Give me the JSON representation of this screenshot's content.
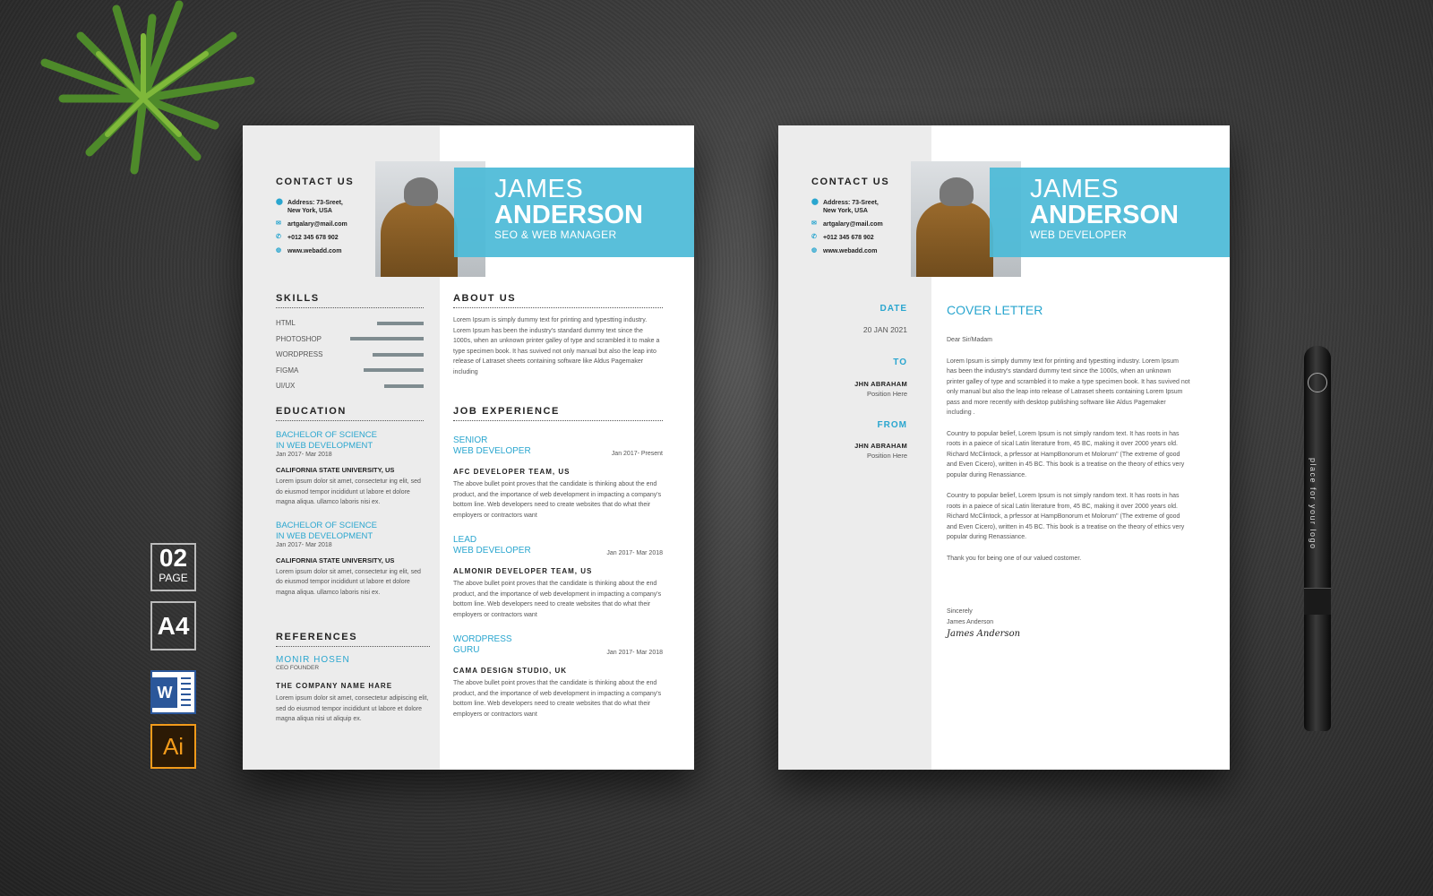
{
  "side_badges": {
    "pages_number": "02",
    "pages_label": "PAGE",
    "paper_size": "A4",
    "word_label": "W",
    "ai_label": "Ai"
  },
  "pen": {
    "logo_text": "place for your logo"
  },
  "resume": {
    "first_name": "JAMES",
    "last_name": "ANDERSON",
    "role": "SEO & WEB MANAGER",
    "contact_title": "CONTACT US",
    "contact": [
      {
        "icon": "location-icon",
        "text": "Address: 73-Sreet,\nNew York, USA"
      },
      {
        "icon": "mail-icon",
        "text": "artgalary@mail.com"
      },
      {
        "icon": "phone-icon",
        "text": "+012 345 678 902"
      },
      {
        "icon": "globe-icon",
        "text": "www.webadd.com"
      }
    ],
    "skills_title": "SKILLS",
    "skills": [
      {
        "name": "HTML",
        "level": 56
      },
      {
        "name": "PHOTOSHOP",
        "level": 89
      },
      {
        "name": "WORDPRESS",
        "level": 62
      },
      {
        "name": "FIGMA",
        "level": 73
      },
      {
        "name": "UI/UX",
        "level": 48
      }
    ],
    "education_title": "EDUCATION",
    "education": [
      {
        "degree1": "BACHELOR OF SCIENCE",
        "degree2": "IN WEB DEVELOPMENT",
        "dates": "Jan 2017- Mar 2018",
        "school": "CALIFORNIA STATE UNIVERSITY, US",
        "desc": "Lorem ipsum dolor sit amet, consectetur ing elit, sed do eiusmod tempor incididunt ut labore et dolore magna aliqua. ullamco laboris nisi ex."
      },
      {
        "degree1": "BACHELOR OF SCIENCE",
        "degree2": "IN WEB DEVELOPMENT",
        "dates": "Jan 2017- Mar 2018",
        "school": "CALIFORNIA STATE UNIVERSITY, US",
        "desc": "Lorem ipsum dolor sit amet, consectetur ing elit, sed do eiusmod tempor incididunt ut labore et dolore magna aliqua. ullamco laboris nisi ex."
      }
    ],
    "references_title": "REFERENCES",
    "reference": {
      "name": "MONIR HOSEN",
      "role": "CEO FOUNDER",
      "company": "THE COMPANY NAME HARE",
      "desc": "Lorem ipsum dolor sit amet, consectetur adipiscing elit, sed do eiusmod tempor incididunt ut labore et dolore magna aliqua nisi ut aliquip ex."
    },
    "about_title": "ABOUT US",
    "about": "Lorem Ipsum is simply dummy text for printing and typestting industry. Lorem Ipsum has been the industry's standard dummy text since the 1000s, when an unknown printer galley of type and scrambled it to make a type specimen book. It has suvived not only manual but also the leap into release of Latraset sheets containing software like Aldus Pagemaker including",
    "jobs_title": "JOB EXPERIENCE",
    "jobs": [
      {
        "title1": "SENIOR",
        "title2": "WEB DEVELOPER",
        "dates": "Jan 2017- Present",
        "company": "AFC DEVELOPER TEAM, US",
        "desc": "The above bullet point proves that the candidate is thinking about the end product, and the importance of web development in impacting a company's bottom line. Web developers need to create websites that do what their employers or contractors want"
      },
      {
        "title1": "LEAD",
        "title2": "WEB DEVELOPER",
        "dates": "Jan 2017- Mar 2018",
        "company": "ALMONIR DEVELOPER TEAM, US",
        "desc": "The above bullet point proves that the candidate is thinking about the end product, and the importance of web development in impacting a company's bottom line. Web developers need to create websites that do what their employers or contractors want"
      },
      {
        "title1": "WORDPRESS",
        "title2": "GURU",
        "dates": "Jan 2017- Mar 2018",
        "company": "CAMA DESIGN STUDIO, UK",
        "desc": "The above bullet point proves that the candidate is thinking about the end product, and the importance of web development in impacting a company's bottom line. Web developers need to create websites that do what their employers or contractors want"
      }
    ]
  },
  "cover": {
    "first_name": "JAMES",
    "last_name": "ANDERSON",
    "role": "WEB DEVELOPER",
    "contact_title": "CONTACT US",
    "contact": [
      {
        "icon": "location-icon",
        "text": "Address: 73-Sreet,\nNew York, USA"
      },
      {
        "icon": "mail-icon",
        "text": "artgalary@mail.com"
      },
      {
        "icon": "phone-icon",
        "text": "+012 345 678 902"
      },
      {
        "icon": "globe-icon",
        "text": "www.webadd.com"
      }
    ],
    "date_label": "DATE",
    "date": "20 JAN 2021",
    "to_label": "TO",
    "to_name": "JHN ABRAHAM",
    "to_position": "Position Here",
    "from_label": "FROM",
    "from_name": "JHN ABRAHAM",
    "from_position": "Position Here",
    "title": "COVER LETTER",
    "greeting": "Dear Sir/Madam",
    "paragraphs": [
      "Lorem Ipsum is simply dummy text for printing and typestting industry. Lorem Ipsum has been the industry's standard dummy text since the 1000s, when an unknown printer galley of type and scrambled it to make a type specimen book. It has suvived not only manual but also the leap into release of Latraset sheets containing Lorem Ipsum pass and more recently with desktop publishing software like Aldus Pagemaker including .",
      "Country to popular belief, Lorem Ipsum is not simply random text. It has roots in has roots in a paiece of sical  Latin literature from, 45 BC, making it over 2000 years old. Richard McClintock, a prfessor at HampBonorum et Molorum\" (The extreme of good and Even Cicero), written in 45 BC. This book is a treatise on the theory of ethics very popular during  Renassiance.",
      "Country to popular belief, Lorem Ipsum is not simply random text. It has roots in  has roots in a paiece of sical  Latin literature from, 45 BC, making it over 2000 years old. Richard McClintock, a prfessor at HampBonorum et Molorum\" (The extreme of good and Even Cicero), written in 45 BC. This book is a treatise on the theory of ethics very popular during  Renassiance.",
      "Thank you for being one of our valued costomer."
    ],
    "closing": "Sincerely",
    "sender": "James Anderson",
    "signature": "James Anderson"
  },
  "colors": {
    "accent": "#4cbad7",
    "sidebar": "#ececec",
    "bar": "#7f8c90"
  }
}
